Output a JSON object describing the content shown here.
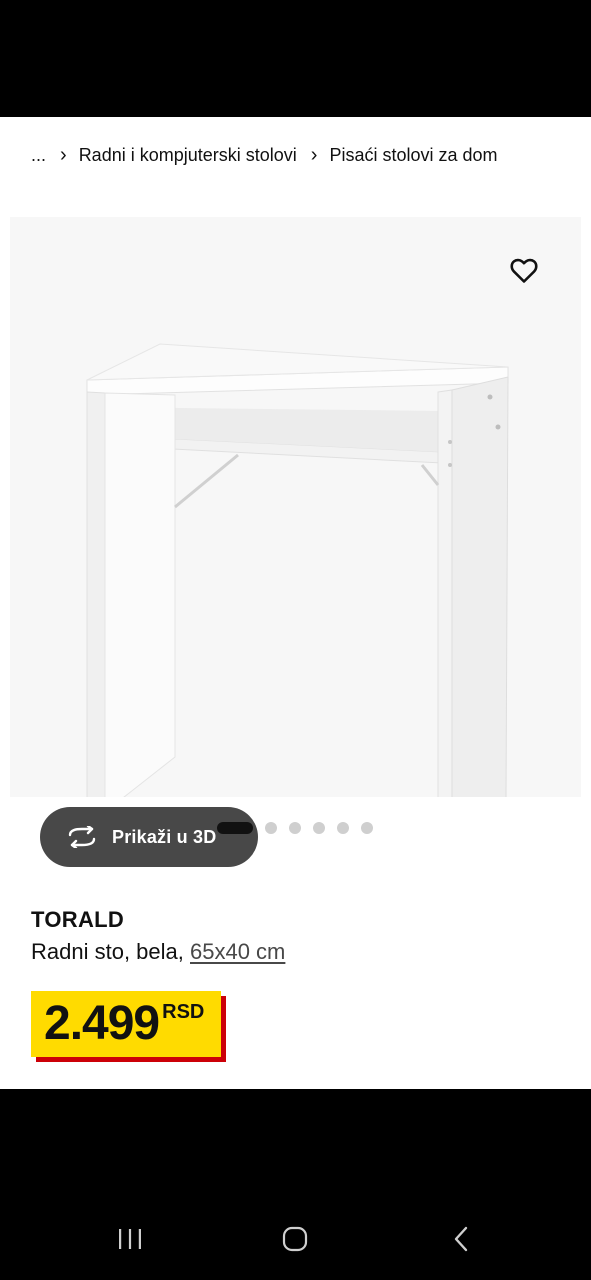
{
  "breadcrumb": {
    "ellipsis": "...",
    "items": [
      "Radni i kompjuterski stolovi",
      "Pisaći stolovi za dom"
    ]
  },
  "gallery": {
    "view_3d_label": "Prikaži u 3D",
    "slide_count": 6,
    "active_slide": 1
  },
  "product": {
    "name": "TORALD",
    "description": "Radni sto, bela,",
    "size": "65x40 cm",
    "price": "2.499",
    "currency": "RSD"
  },
  "colors": {
    "price_background": "#ffdb00",
    "price_shadow": "#cc0008",
    "button_background": "#484848"
  },
  "icons": {
    "favorite": "heart-icon",
    "rotate": "rotate-3d-icon",
    "nav_recents": "recents-icon",
    "nav_home": "home-icon",
    "nav_back": "back-icon"
  }
}
